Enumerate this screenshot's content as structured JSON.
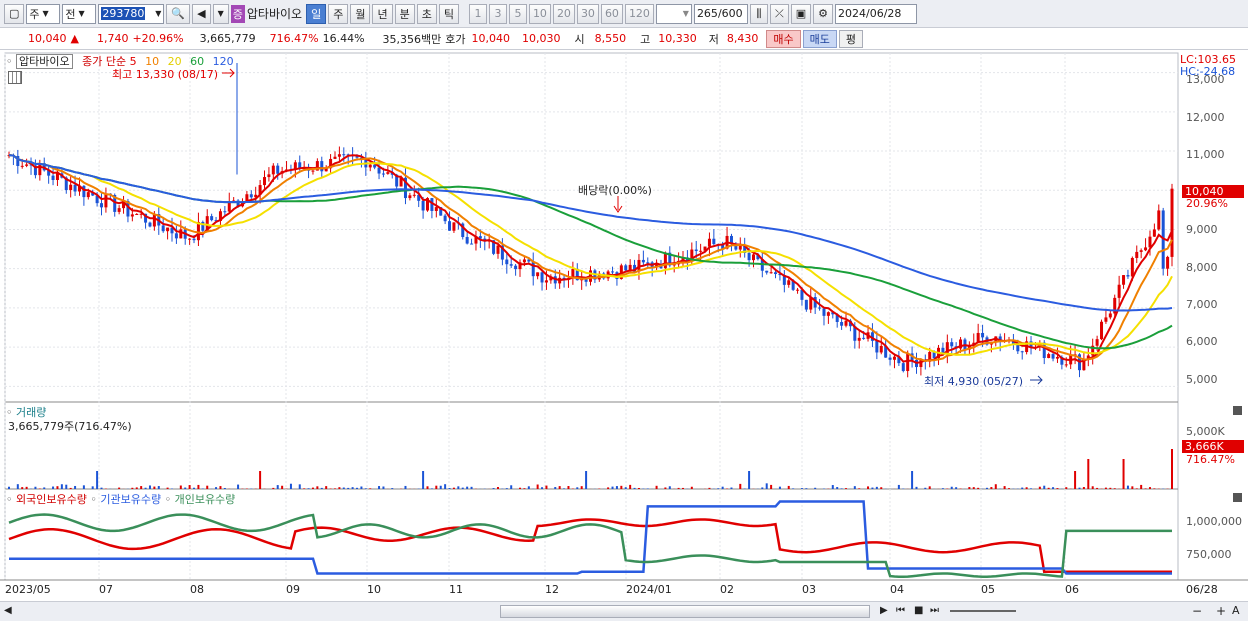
{
  "toolbar": {
    "type_value": "주",
    "all_label": "전",
    "code_value": "293780",
    "stock_name": "압타바이오",
    "stock_badge": "증",
    "periods": [
      "일",
      "주",
      "월",
      "년",
      "분",
      "초",
      "틱"
    ],
    "active_period": "일",
    "intervals": [
      "1",
      "3",
      "5",
      "10",
      "20",
      "30",
      "60",
      "120"
    ],
    "count_value": "265",
    "count_total": "/600",
    "date_value": "2024/06/28"
  },
  "quote": {
    "price": "10,040",
    "arrow": "▲",
    "change": "1,740",
    "change_pct": "+20.96%",
    "volume": "3,665,779",
    "volume_pct": "716.47%",
    "turnover": "16.44%",
    "amount": "35,356백만",
    "bid_label": "호가",
    "bid1": "10,040",
    "bid2": "10,030",
    "open_label": "시",
    "open": "8,550",
    "high_label": "고",
    "high": "10,330",
    "low_label": "저",
    "low": "8,430",
    "buy_label": "매수",
    "sell_label": "매도",
    "eval_label": "평"
  },
  "price_panel": {
    "stock_tag": "압타바이오",
    "ma_label": "종가 단순",
    "ma_periods": [
      "5",
      "10",
      "20",
      "60",
      "120"
    ],
    "ma_colors": [
      "#e00000",
      "#f08000",
      "#f5e000",
      "#1a9f3a",
      "#2b5ce0"
    ],
    "max_label": "최고 13,330 (08/17)",
    "min_label": "최저 4,930 (05/27)",
    "dividend_label": "배당락(0.00%)",
    "lc_label": "LC:103.65",
    "hc_label": "HC:-24.68",
    "y_ticks": [
      "13,000",
      "12,000",
      "11,000",
      "10,000",
      "9,000",
      "8,000",
      "7,000",
      "6,000",
      "5,000"
    ],
    "last_price_tag": "10,040",
    "last_pct_tag": "20.96%"
  },
  "volume_panel": {
    "title": "거래량",
    "value": "3,665,779주(716.47%)",
    "y_ticks": [
      "5,000K",
      "4,000K"
    ],
    "last_tag": "3,666K",
    "last_pct": "716.47%"
  },
  "holdings_panel": {
    "foreign_label": "외국인보유수량",
    "inst_label": "기관보유수량",
    "indiv_label": "개인보유수량",
    "y_ticks": [
      "1,000,000",
      "750,000"
    ],
    "colors": {
      "foreign": "#e00000",
      "inst": "#2b5ce0",
      "indiv": "#3a8f5a"
    }
  },
  "x_axis": [
    "2023/05",
    "07",
    "08",
    "09",
    "10",
    "11",
    "12",
    "2024/01",
    "02",
    "03",
    "04",
    "05",
    "06",
    "06/28"
  ],
  "chart_data": {
    "type": "candlestick",
    "approx_close_by_month": [
      {
        "month": "2023/05",
        "close": 10900
      },
      {
        "month": "2023/06",
        "close": 9800
      },
      {
        "month": "2023/07",
        "close": 8800
      },
      {
        "month": "2023/08",
        "close": 10500
      },
      {
        "month": "2023/09",
        "close": 10800
      },
      {
        "month": "2023/10",
        "close": 9000
      },
      {
        "month": "2023/11",
        "close": 7800
      },
      {
        "month": "2023/12",
        "close": 8000
      },
      {
        "month": "2024/01",
        "close": 8700
      },
      {
        "month": "2024/02",
        "close": 7000
      },
      {
        "month": "2024/03",
        "close": 5600
      },
      {
        "month": "2024/04",
        "close": 6300
      },
      {
        "month": "2024/05",
        "close": 5600
      },
      {
        "month": "2024/06",
        "close": 10040
      }
    ],
    "high": 13330,
    "low": 4930,
    "ylim": [
      4600,
      13500
    ]
  }
}
